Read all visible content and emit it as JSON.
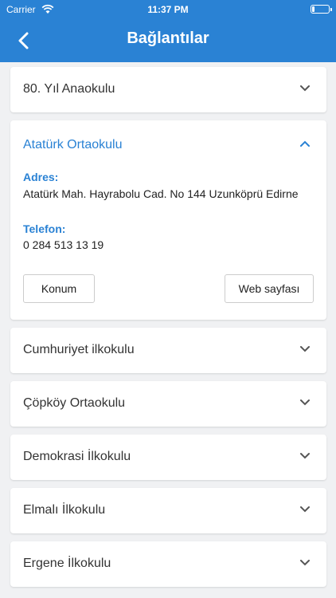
{
  "status_bar": {
    "carrier": "Carrier",
    "time": "11:37 PM"
  },
  "header": {
    "title": "Bağlantılar",
    "back_icon": "chevron-left-icon"
  },
  "colors": {
    "accent": "#2a82d4",
    "background": "#f0f1f3"
  },
  "items": [
    {
      "name": "80. Yıl Anaokulu",
      "expanded": false
    },
    {
      "name": "Atatürk Ortaokulu",
      "expanded": true,
      "address_label": "Adres:",
      "address": "Atatürk Mah. Hayrabolu Cad. No 144 Uzunköprü Edirne",
      "phone_label": "Telefon:",
      "phone": "0 284 513 13 19",
      "location_button": "Konum",
      "website_button": "Web sayfası"
    },
    {
      "name": "Cumhuriyet ilkokulu",
      "expanded": false
    },
    {
      "name": "Çöpköy Ortaokulu",
      "expanded": false
    },
    {
      "name": "Demokrasi İlkokulu",
      "expanded": false
    },
    {
      "name": "Elmalı İlkokulu",
      "expanded": false
    },
    {
      "name": "Ergene İlkokulu",
      "expanded": false
    }
  ]
}
